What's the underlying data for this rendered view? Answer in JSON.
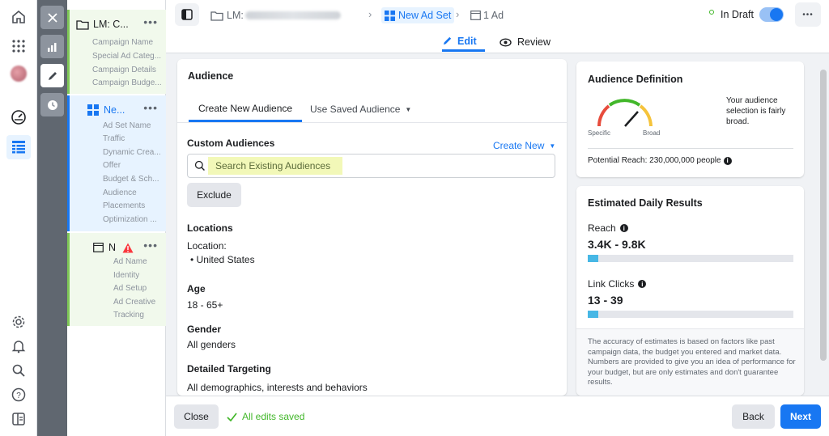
{
  "tree": {
    "campaign": {
      "title": "LM: C...",
      "items": [
        "Campaign Name",
        "Special Ad Categ...",
        "Campaign Details",
        "Campaign Budge..."
      ]
    },
    "adset": {
      "title": "Ne...",
      "items": [
        "Ad Set Name",
        "Traffic",
        "Dynamic Crea...",
        "Offer",
        "Budget & Sch...",
        "Audience",
        "Placements",
        "Optimization ..."
      ]
    },
    "ad": {
      "title": "N",
      "items": [
        "Ad Name",
        "Identity",
        "Ad Setup",
        "Ad Creative",
        "Tracking"
      ]
    },
    "more": "•••"
  },
  "header": {
    "crumb_campaign_prefix": "LM:",
    "crumb_adset": "New Ad Set",
    "crumb_ad": "1 Ad",
    "status": "In Draft",
    "more": "•••",
    "tabs": {
      "edit": "Edit",
      "review": "Review"
    }
  },
  "main": {
    "title": "Audience",
    "tabs": {
      "create": "Create New Audience",
      "saved": "Use Saved Audience"
    },
    "custom_audiences_label": "Custom Audiences",
    "create_new": "Create New",
    "search_placeholder": "Search Existing Audiences",
    "exclude": "Exclude",
    "locations_label": "Locations",
    "location_sub": "Location:",
    "location_value": "United States",
    "age_label": "Age",
    "age_value": "18 - 65+",
    "gender_label": "Gender",
    "gender_value": "All genders",
    "targeting_label": "Detailed Targeting",
    "targeting_value": "All demographics, interests and behaviors"
  },
  "definition": {
    "title": "Audience Definition",
    "gauge_specific": "Specific",
    "gauge_broad": "Broad",
    "description": "Your audience selection is fairly broad.",
    "potential_reach": "Potential Reach: 230,000,000 people"
  },
  "estimates": {
    "title": "Estimated Daily Results",
    "reach_label": "Reach",
    "reach_value": "3.4K - 9.8K",
    "reach_fill": 0.05,
    "clicks_label": "Link Clicks",
    "clicks_value": "13 - 39",
    "clicks_fill": 0.05,
    "note": "The accuracy of estimates is based on factors like past campaign data, the budget you entered and market data. Numbers are provided to give you an idea of performance for your budget, but are only estimates and don't guarantee results."
  },
  "footer": {
    "close": "Close",
    "saved": "All edits saved",
    "back": "Back",
    "next": "Next"
  },
  "colors": {
    "accent": "#1877f2",
    "success": "#42b72a",
    "warning": "#fa383e",
    "bar": "#47b7e5"
  }
}
